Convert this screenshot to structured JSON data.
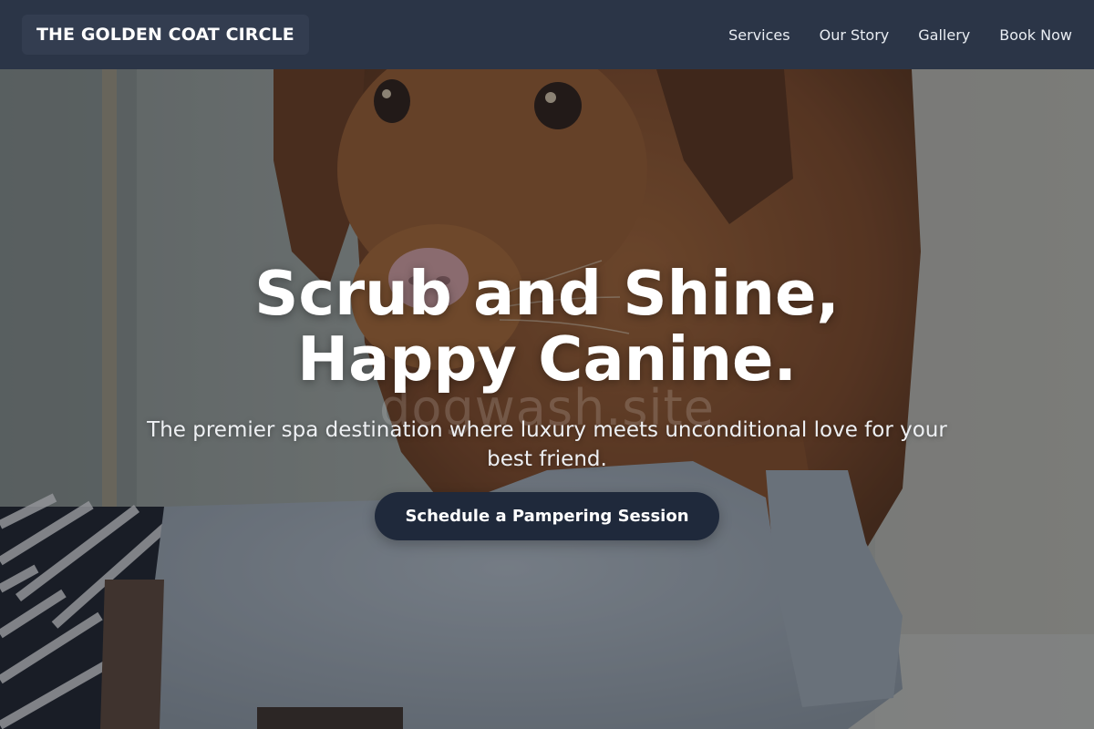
{
  "header": {
    "brand": "THE GOLDEN COAT CIRCLE",
    "nav": [
      {
        "label": "Services"
      },
      {
        "label": "Our Story"
      },
      {
        "label": "Gallery"
      },
      {
        "label": "Book Now"
      }
    ]
  },
  "hero": {
    "headline_line1": "Scrub and Shine,",
    "headline_line2": "Happy Canine.",
    "watermark": "dogwash.site",
    "subtitle": "The premier spa destination where luxury meets unconditional love for your best friend.",
    "cta_label": "Schedule a Pampering Session"
  },
  "colors": {
    "header_bg": "#2b3547",
    "cta_bg": "#1f293b",
    "text_light": "#ffffff"
  }
}
